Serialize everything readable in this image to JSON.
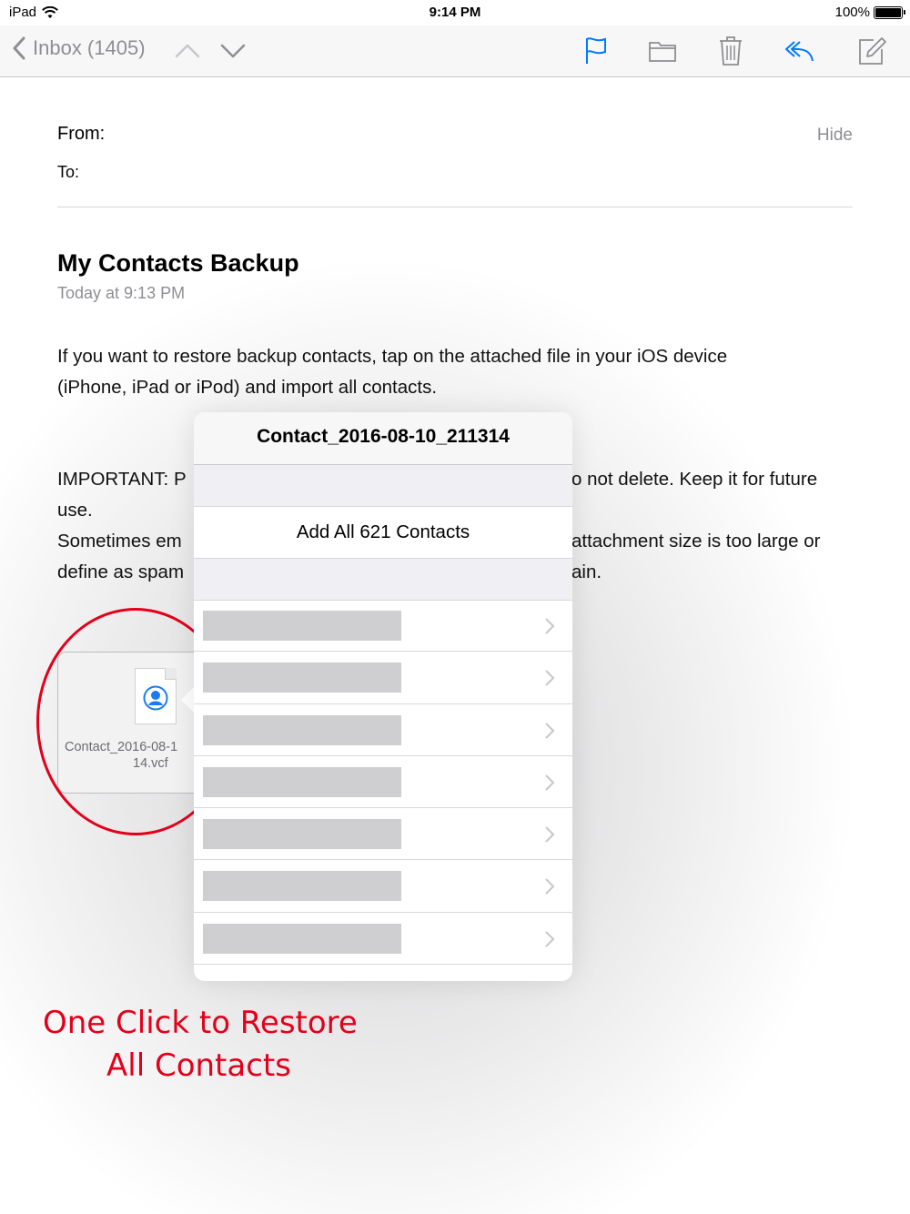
{
  "status_bar": {
    "device": "iPad",
    "time": "9:14 PM",
    "battery": "100%"
  },
  "nav": {
    "back_label": "Inbox (1405)",
    "icons": [
      "chevron-left-icon",
      "chevron-up-icon",
      "chevron-down-icon",
      "flag-icon",
      "folder-icon",
      "trash-icon",
      "reply-icon",
      "compose-icon"
    ],
    "accent": "#007aff"
  },
  "header": {
    "from_label": "From:",
    "to_label": "To:",
    "hide_label": "Hide"
  },
  "message": {
    "subject": "My Contacts Backup",
    "date": "Today at 9:13 PM",
    "body_line1": "If you want to restore backup contacts, tap on the attached file in your iOS device",
    "body_line2": "(iPhone, iPad or iPod) and import all contacts.",
    "important_left": "IMPORTANT: P",
    "important_right": "o not delete. Keep it for future",
    "use_line": "use.",
    "sometimes_left": "Sometimes em",
    "sometimes_right": "attachment size is too large or",
    "define_left": "define as spam",
    "define_right": "ain."
  },
  "attachment": {
    "line1": "Contact_2016-08-1",
    "line2": "14.vcf",
    "icon": "contact-card-icon"
  },
  "popover": {
    "title": "Contact_2016-08-10_211314",
    "add_all_label": "Add All 621 Contacts",
    "row_count": 7
  },
  "annotation": {
    "line1": "One Click to Restore",
    "line2": "All Contacts",
    "color": "#e3001b"
  }
}
